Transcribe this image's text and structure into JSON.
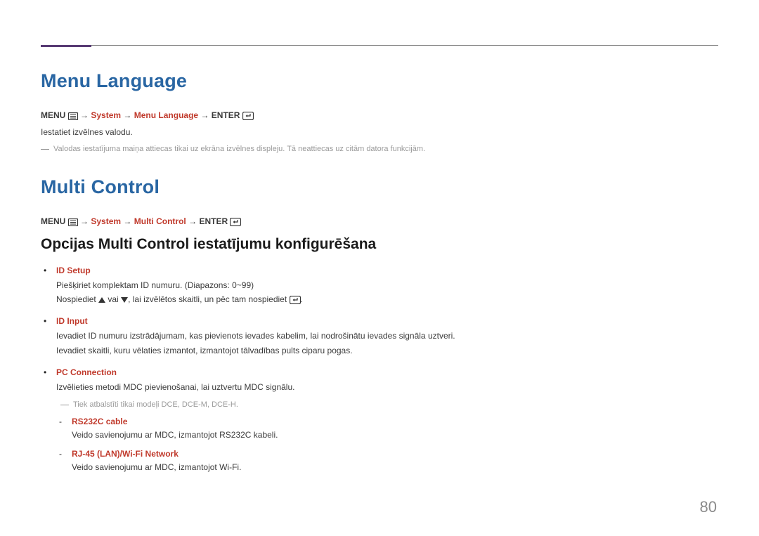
{
  "page_number": "80",
  "section1": {
    "title": "Menu Language",
    "path_prefix": "MENU",
    "path_red": "System",
    "path_mid": "Menu Language",
    "path_suffix": "ENTER",
    "body": "Iestatiet izvēlnes valodu.",
    "note": "Valodas iestatījuma maiņa attiecas tikai uz ekrāna izvēlnes displeju. Tā neattiecas uz citām datora funkcijām."
  },
  "section2": {
    "title": "Multi Control",
    "path_prefix": "MENU",
    "path_red": "System",
    "path_mid": "Multi Control",
    "path_suffix": "ENTER",
    "subhead": "Opcijas Multi Control iestatījumu konfigurēšana",
    "bullets": [
      {
        "title": "ID Setup",
        "line1": "Piešķiriet komplektam ID numuru. (Diapazons: 0~99)",
        "line2a": "Nospiediet ",
        "line2b": " vai ",
        "line2c": ", lai izvēlētos skaitli, un pēc tam nospiediet ",
        "line2d": "."
      },
      {
        "title": "ID Input",
        "line1": "Ievadiet ID numuru izstrādājumam, kas pievienots ievades kabelim, lai nodrošinātu ievades signāla uztveri.",
        "line2": "Ievadiet skaitli, kuru vēlaties izmantot, izmantojot tālvadības pults ciparu pogas."
      },
      {
        "title": "PC Connection",
        "line1": "Izvēlieties metodi MDC pievienošanai, lai uztvertu MDC signālu.",
        "note": "Tiek atbalstīti tikai modeļi DCE, DCE-M, DCE-H.",
        "dashes": [
          {
            "title": "RS232C cable",
            "body": "Veido savienojumu ar MDC, izmantojot RS232C kabeli."
          },
          {
            "title": "RJ-45 (LAN)/Wi-Fi Network",
            "body": "Veido savienojumu ar MDC, izmantojot Wi-Fi."
          }
        ]
      }
    ]
  }
}
